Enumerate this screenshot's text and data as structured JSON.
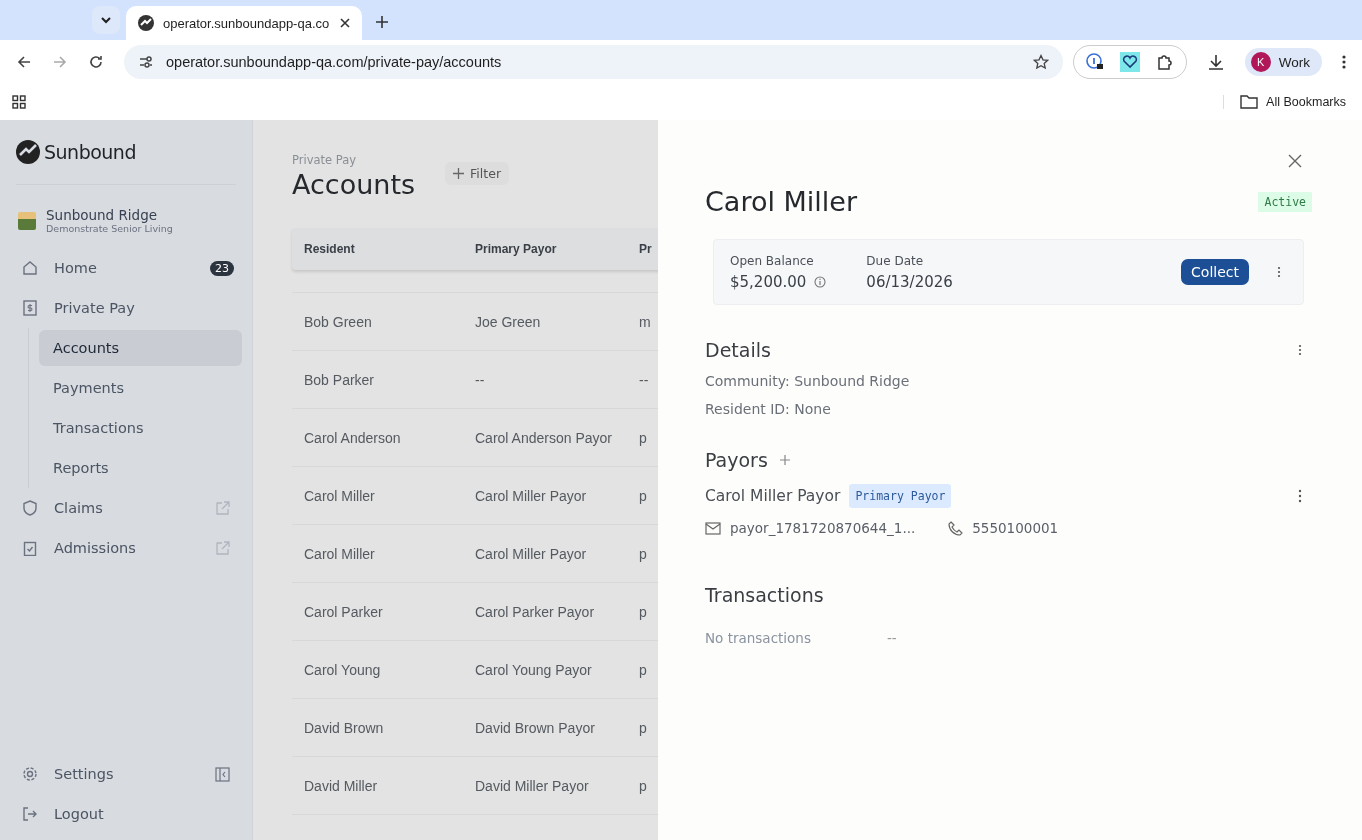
{
  "browser": {
    "tab": {
      "title": "operator.sunboundapp-qa.co",
      "selected": true
    },
    "url": "operator.sunboundapp-qa.com/private-pay/accounts",
    "profile": {
      "initial": "K",
      "name": "Work"
    },
    "bookmarks_label": "All Bookmarks"
  },
  "sidebar": {
    "brand": "Sunbound",
    "community": {
      "name": "Sunbound Ridge",
      "subtitle": "Demonstrate Senior Living"
    },
    "items": [
      {
        "kind": "home",
        "label": "Home",
        "badge": "23",
        "selected": false,
        "external": false
      },
      {
        "kind": "dollar",
        "label": "Private Pay",
        "selected": false,
        "external": false,
        "children": [
          {
            "label": "Accounts",
            "selected": true
          },
          {
            "label": "Payments",
            "selected": false
          },
          {
            "label": "Transactions",
            "selected": false
          },
          {
            "label": "Reports",
            "selected": false
          }
        ]
      },
      {
        "kind": "shield",
        "label": "Claims",
        "selected": false,
        "external": true
      },
      {
        "kind": "clipboard",
        "label": "Admissions",
        "selected": false,
        "external": true
      }
    ],
    "footer": [
      {
        "kind": "settings",
        "label": "Settings"
      },
      {
        "kind": "logout",
        "label": "Logout"
      }
    ]
  },
  "page": {
    "breadcrumb": "Private Pay",
    "title": "Accounts",
    "filter_button": "Filter",
    "table": {
      "columns": [
        "Resident",
        "Primary Payor",
        "Pr"
      ],
      "rows": [
        [
          "Bob Green",
          "Joe Green",
          "m"
        ],
        [
          "Bob Parker",
          "--",
          "--"
        ],
        [
          "Carol Anderson",
          "Carol Anderson Payor",
          "p"
        ],
        [
          "Carol Miller",
          "Carol Miller Payor",
          "p"
        ],
        [
          "Carol Miller",
          "Carol Miller Payor",
          "p"
        ],
        [
          "Carol Parker",
          "Carol Parker Payor",
          "p"
        ],
        [
          "Carol Young",
          "Carol Young Payor",
          "p"
        ],
        [
          "David Brown",
          "David Brown Payor",
          "p"
        ],
        [
          "David Miller",
          "David Miller Payor",
          "p"
        ]
      ]
    }
  },
  "drawer": {
    "name": "Carol Miller",
    "status": "Active",
    "balance": {
      "label": "Open Balance",
      "value": "$5,200.00"
    },
    "due": {
      "label": "Due Date",
      "value": "06/13/2026"
    },
    "collect_button": "Collect",
    "details": {
      "title": "Details",
      "lines": [
        "Community: Sunbound Ridge",
        "Resident ID: None"
      ]
    },
    "payors": {
      "title": "Payors",
      "items": [
        {
          "name": "Carol Miller Payor",
          "tag": "Primary Payor",
          "email": "payor_1781720870644_1...",
          "phone": "5550100001"
        }
      ]
    },
    "transactions": {
      "title": "Transactions",
      "empty": "No transactions",
      "empty_value": "--"
    }
  }
}
